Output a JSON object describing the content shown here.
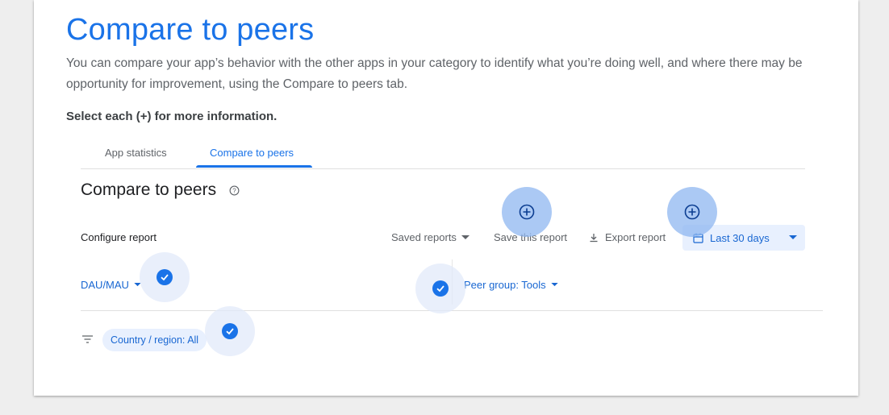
{
  "page": {
    "title": "Compare to peers",
    "description": "You can compare your app’s behavior with the other apps in your category to identify what you’re doing well, and where there may be opportunity for improvement, using the Compare to peers tab.",
    "instruction": "Select each (+) for more information."
  },
  "tabs": [
    {
      "label": "App statistics",
      "active": false
    },
    {
      "label": "Compare to peers",
      "active": true
    }
  ],
  "report": {
    "title": "Compare to peers",
    "configure_label": "Configure report",
    "saved_reports_label": "Saved reports",
    "save_this_label": "Save this report",
    "export_label": "Export report",
    "date_range_label": "Last 30 days",
    "metric_label": "DAU/MAU",
    "peer_group_label": "Peer group: Tools",
    "filter_chip_label": "Country / region: All"
  },
  "icons": {
    "help": "help-circle-icon",
    "saved_caret": "caret-down-icon",
    "download": "download-icon",
    "calendar": "calendar-icon",
    "plus_hotspot": "plus-circle-icon",
    "check_hotspot": "check-circle-icon",
    "filter": "filter-icon"
  },
  "colors": {
    "accent": "#1a73e8",
    "chip_bg": "#e8f0fe",
    "hotspot_plus": "#8fb7f0",
    "hotspot_check": "#e1eafa"
  }
}
